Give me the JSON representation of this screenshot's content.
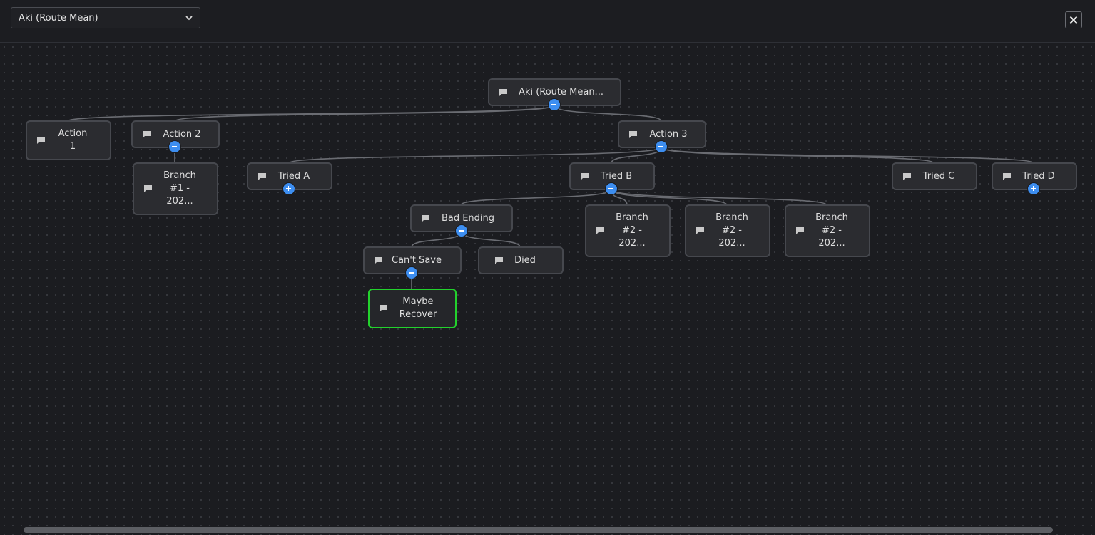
{
  "header": {
    "route_select_value": "Aki (Route Mean)",
    "close_label": "×"
  },
  "tree": {
    "root": {
      "label": "Aki (Route Mean...",
      "state": "expanded"
    },
    "action1": {
      "line1": "Action",
      "line2": "1"
    },
    "action2": {
      "label": "Action 2",
      "state": "expanded"
    },
    "branch1": {
      "line1": "Branch",
      "line2": "#1 -",
      "line3": "202..."
    },
    "action3": {
      "label": "Action 3",
      "state": "expanded"
    },
    "tried_a": {
      "label": "Tried A",
      "state": "collapsed"
    },
    "tried_b": {
      "label": "Tried B",
      "state": "expanded"
    },
    "tried_c": {
      "label": "Tried C"
    },
    "tried_d": {
      "label": "Tried D",
      "state": "collapsed"
    },
    "bad_ending": {
      "label": "Bad Ending",
      "state": "expanded"
    },
    "branch2a": {
      "line1": "Branch",
      "line2": "#2 -",
      "line3": "202..."
    },
    "branch2b": {
      "line1": "Branch",
      "line2": "#2 -",
      "line3": "202..."
    },
    "branch2c": {
      "line1": "Branch",
      "line2": "#2 -",
      "line3": "202..."
    },
    "cant_save": {
      "label": "Can't Save",
      "state": "expanded"
    },
    "died": {
      "label": "Died"
    },
    "maybe_recover": {
      "line1": "Maybe",
      "line2": "Recover",
      "selected": true
    }
  },
  "colors": {
    "selected_border": "#23d22d",
    "toggle": "#3d8ef0"
  }
}
